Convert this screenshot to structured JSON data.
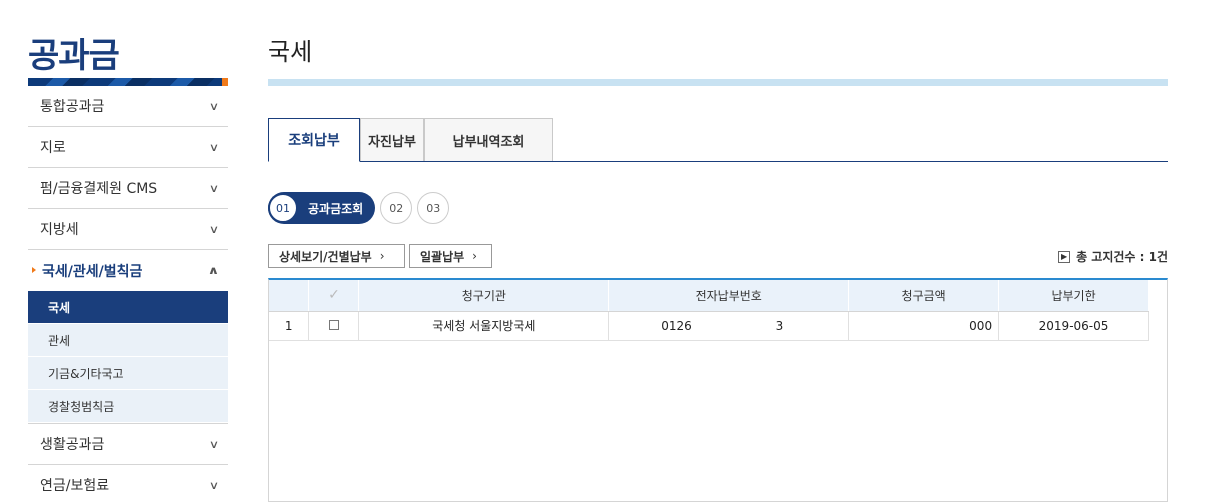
{
  "sidebar": {
    "brand": "공과금",
    "items": [
      {
        "label": "통합공과금"
      },
      {
        "label": "지로"
      },
      {
        "label": "펌/금융결제원 CMS"
      },
      {
        "label": "지방세"
      },
      {
        "label": "국세/관세/벌칙금"
      },
      {
        "label": "생활공과금"
      },
      {
        "label": "연금/보험료"
      }
    ],
    "sub_items": [
      {
        "label": "국세"
      },
      {
        "label": "관세"
      },
      {
        "label": "기금&기타국고"
      },
      {
        "label": "경찰청범칙금"
      }
    ]
  },
  "main": {
    "title": "국세",
    "tabs": [
      {
        "label": "조회납부"
      },
      {
        "label": "자진납부"
      },
      {
        "label": "납부내역조회"
      }
    ],
    "steps": {
      "active_num": "01",
      "active_label": "공과금조회",
      "step2": "02",
      "step3": "03"
    },
    "buttons": {
      "detail": "상세보기/건별납부",
      "bulk": "일괄납부",
      "gt": "›"
    },
    "count_text": "총 고지건수 : 1건",
    "table": {
      "headers": [
        "",
        "✓",
        "청구기관",
        "전자납부번호",
        "청구금액",
        "납부기한"
      ],
      "rows": [
        {
          "no": "1",
          "agency": "국세청 서울지방국세",
          "pay_no_a": "0126",
          "pay_no_b": "3",
          "amount": "000",
          "due": "2019-06-05"
        }
      ]
    }
  }
}
